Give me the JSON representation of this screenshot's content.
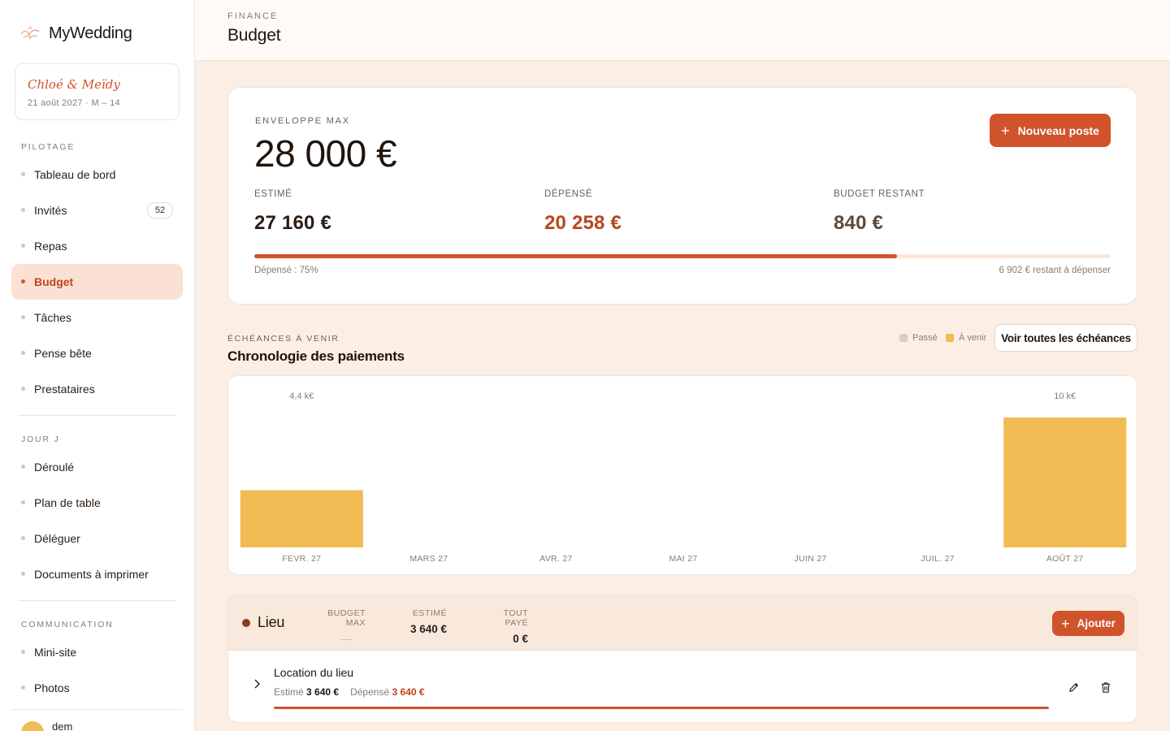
{
  "app": {
    "name": "MyWedding",
    "couple_name": "Chloé & Meïdy",
    "couple_date": "21 août 2027 · M – 14",
    "user_name": "dem"
  },
  "sidebar": {
    "sections": [
      {
        "label": "PILOTAGE"
      },
      {
        "label": "JOUR J"
      },
      {
        "label": "COMMUNICATION"
      }
    ],
    "items": [
      {
        "label": "Tableau de bord"
      },
      {
        "label": "Invités",
        "badge": "52"
      },
      {
        "label": "Repas"
      },
      {
        "label": "Budget",
        "active": true
      },
      {
        "label": "Tâches"
      },
      {
        "label": "Pense bête"
      },
      {
        "label": "Prestataires"
      },
      {
        "label": "Déroulé"
      },
      {
        "label": "Plan de table"
      },
      {
        "label": "Déléguer"
      },
      {
        "label": "Documents à imprimer"
      },
      {
        "label": "Mini-site"
      },
      {
        "label": "Photos"
      }
    ]
  },
  "header": {
    "kicker": "FINANCE",
    "title": "Budget"
  },
  "budget": {
    "envelope_label": "ENVELOPPE MAX",
    "envelope_value": "28 000 €",
    "new_button": "Nouveau poste",
    "stats": [
      {
        "label": "ESTIMÉ",
        "value": "27 160 €",
        "color": "#2a1d14"
      },
      {
        "label": "DÉPENSÉ",
        "value": "20 258 €",
        "color": "#b8451f"
      },
      {
        "label": "BUDGET RESTANT",
        "value": "840 €",
        "color": "#5b4b3f"
      }
    ],
    "progress_pct": 75,
    "progress_left": "Dépensé : 75%",
    "progress_right": "6 902 € restant à dépenser"
  },
  "payments": {
    "kicker": "ÉCHÉANCES À VENIR",
    "title": "Chronologie des paiements",
    "legend": {
      "past": "Passé",
      "upcoming": "À venir"
    },
    "view_all": "Voir toutes les échéances"
  },
  "chart_data": {
    "type": "bar",
    "categories": [
      "FEVR. 27",
      "MARS 27",
      "AVR. 27",
      "MAI 27",
      "JUIN 27",
      "JUIL. 27",
      "AOÛT 27"
    ],
    "series": [
      {
        "values": [
          4.4,
          0,
          0,
          0,
          0,
          0,
          10
        ]
      }
    ],
    "data_labels": [
      "4,4 k€",
      "",
      "",
      "",
      "",
      "",
      "10 k€"
    ],
    "ylim": [
      0,
      10
    ],
    "colors": {
      "upcoming": "#f0bc53",
      "past": "#d9cfc6"
    }
  },
  "category": {
    "name": "Lieu",
    "cols": [
      {
        "label": "BUDGET MAX",
        "value": "—"
      },
      {
        "label": "ESTIMÉ",
        "value": "3 640 €"
      },
      {
        "label": "TOUT PAYÉ",
        "value": "0 €"
      }
    ],
    "add_button": "Ajouter",
    "item": {
      "title": "Location du lieu",
      "estimated_label": "Estimé",
      "estimated_value": "3 640 €",
      "spent_label": "Dépensé",
      "spent_value": "3 640 €"
    }
  },
  "colors": {
    "accent": "#d0532b",
    "accent_soft": "#fbe1d3",
    "bar": "#f0bc53"
  }
}
